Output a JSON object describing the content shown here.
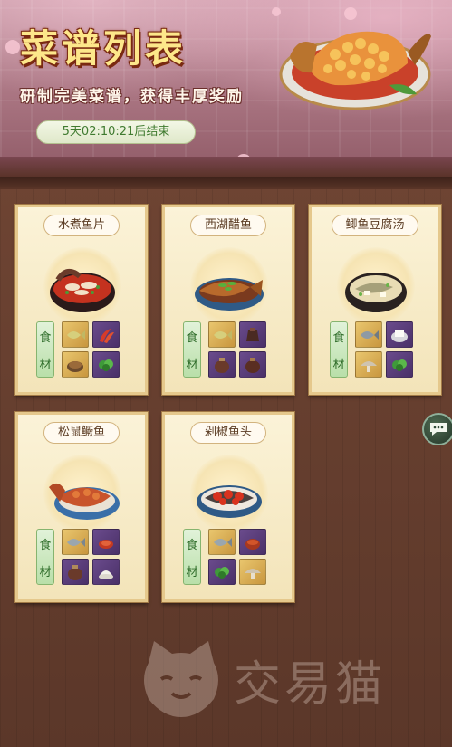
{
  "header": {
    "title": "菜谱列表",
    "subtitle": "研制完美菜谱，获得丰厚奖励",
    "timer": "5天02:10:21后结束"
  },
  "ingredient_label": [
    "食",
    "材"
  ],
  "recipes": [
    {
      "name": "水煮鱼片",
      "dish_icon": "boiled-fish-slices-icon",
      "ingredients": [
        "fish-icon",
        "chili-icon",
        "meat-bowl-icon",
        "greens-icon"
      ],
      "frames": [
        "gold",
        "purple",
        "gold",
        "purple"
      ]
    },
    {
      "name": "西湖醋鱼",
      "dish_icon": "west-lake-vinegar-fish-icon",
      "ingredients": [
        "fish-icon",
        "vinegar-jar-icon",
        "wine-jar-icon",
        "wine-jar-icon"
      ],
      "frames": [
        "gold",
        "purple",
        "purple",
        "purple"
      ]
    },
    {
      "name": "鲫鱼豆腐汤",
      "dish_icon": "crucian-tofu-soup-icon",
      "ingredients": [
        "fish-icon",
        "tofu-icon",
        "mushroom-icon",
        "greens-icon"
      ],
      "frames": [
        "gold",
        "purple",
        "gold",
        "purple"
      ]
    },
    {
      "name": "松鼠鳜鱼",
      "dish_icon": "squirrel-mandarin-fish-icon",
      "ingredients": [
        "fish-icon",
        "sauce-icon",
        "wine-jar-icon",
        "flour-icon"
      ],
      "frames": [
        "gold",
        "purple",
        "purple",
        "purple"
      ]
    },
    {
      "name": "剁椒鱼头",
      "dish_icon": "chopped-chili-fish-head-icon",
      "ingredients": [
        "fish-icon",
        "chili-sauce-icon",
        "greens-icon",
        "mushroom-icon"
      ],
      "frames": [
        "gold",
        "purple",
        "purple",
        "gold"
      ]
    }
  ],
  "watermark": "交易猫",
  "colors": {
    "title": "#fde78a",
    "timer_text": "#3f7a2f",
    "card_bg": "#fbf3d8",
    "label_green": "#b9dfa9",
    "frame_gold": "#d9ad55",
    "frame_purple": "#5a3b7a"
  }
}
